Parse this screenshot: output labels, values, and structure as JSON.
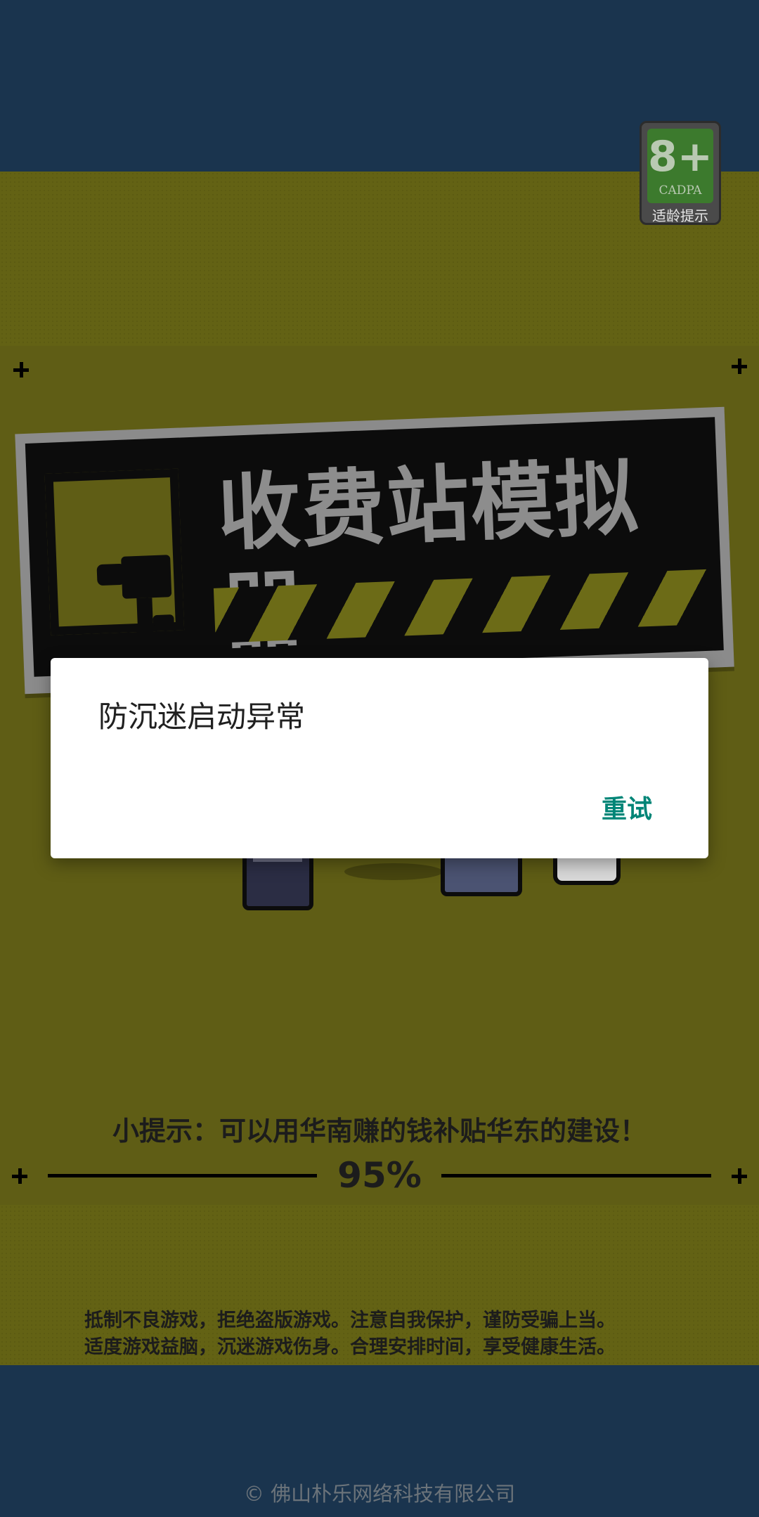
{
  "rating_badge": {
    "age": "8+",
    "org": "CADPA",
    "label": "适龄提示"
  },
  "logo": {
    "title": "收费站模拟器"
  },
  "dialog": {
    "title": "防沉迷启动异常",
    "retry_label": "重试"
  },
  "loading": {
    "hint": "小提示：可以用华南赚的钱补贴华东的建设！",
    "progress_text": "95%",
    "progress_value": 0.95
  },
  "notice": {
    "line1": "抵制不良游戏，拒绝盗版游戏。注意自我保护，谨防受骗上当。",
    "line2": "适度游戏益脑，沉迷游戏伤身。合理安排时间，享受健康生活。"
  },
  "footer": {
    "copyright": "© 佛山朴乐网络科技有限公司"
  },
  "colors": {
    "accent": "#008577",
    "brand_yellow": "#5f5d15",
    "brand_blue": "#1a344e"
  }
}
